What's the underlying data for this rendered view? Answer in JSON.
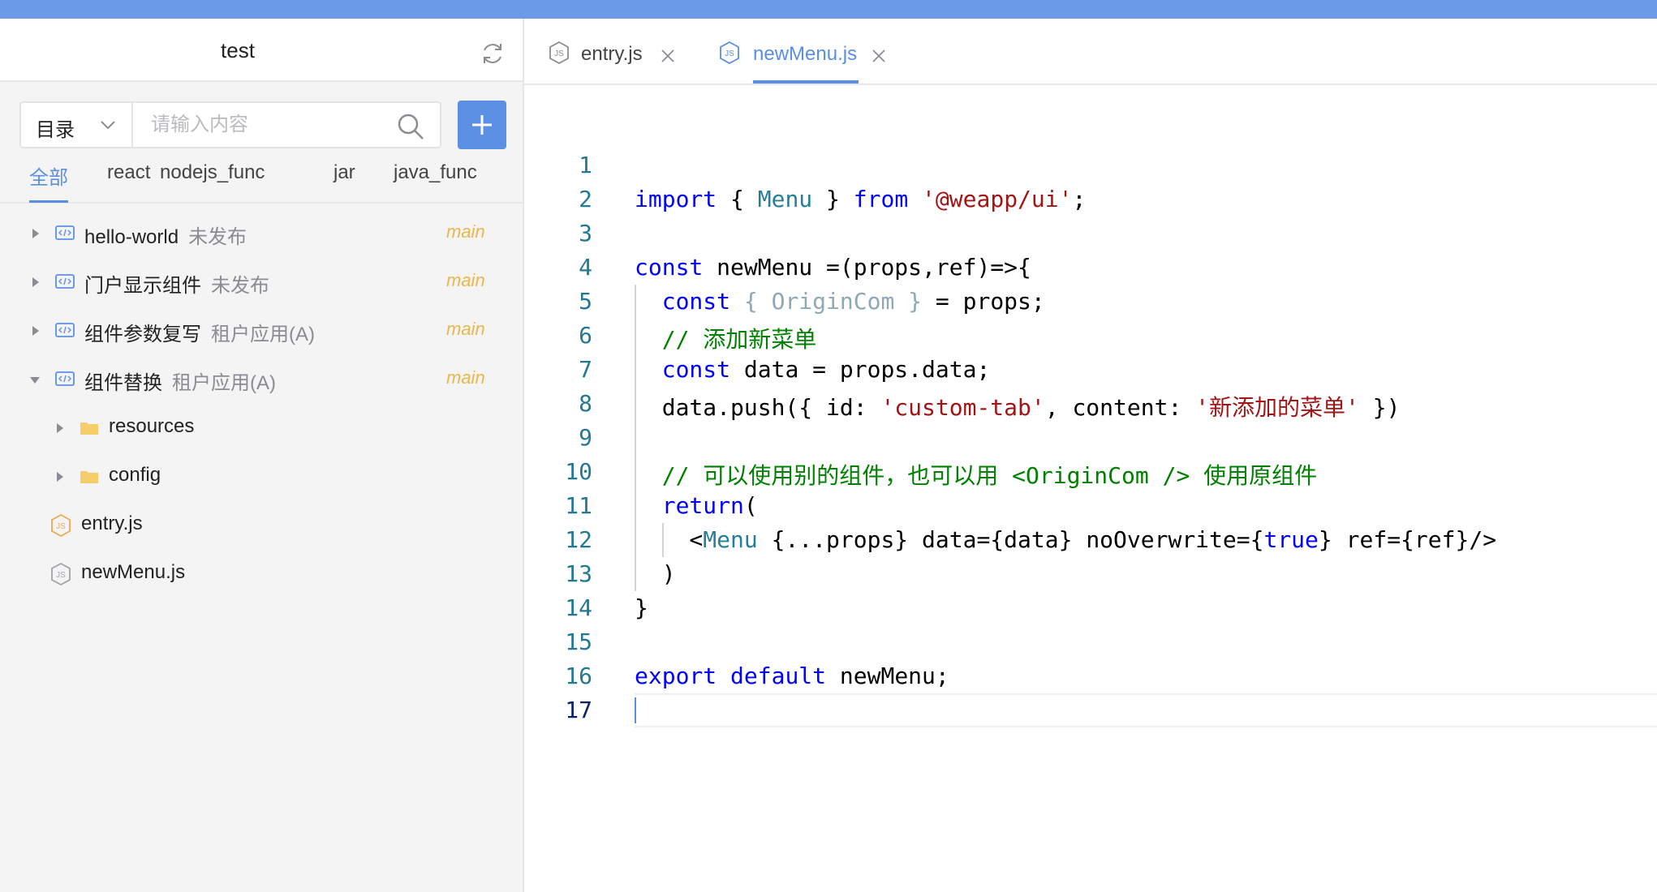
{
  "sidebar": {
    "title": "test",
    "search": {
      "scope": "目录",
      "placeholder": "请输入内容",
      "value": ""
    },
    "filter_tabs": [
      "全部",
      "react",
      "nodejs_func",
      "jar",
      "java_func"
    ],
    "active_filter": "全部",
    "tree": [
      {
        "name": "hello-world",
        "status": "未发布",
        "branch": "main",
        "type": "component",
        "expanded": false
      },
      {
        "name": "门户显示组件",
        "status": "未发布",
        "branch": "main",
        "type": "component",
        "expanded": false
      },
      {
        "name": "组件参数复写",
        "status": "租户应用(A)",
        "branch": "main",
        "type": "component",
        "expanded": false
      },
      {
        "name": "组件替换",
        "status": "租户应用(A)",
        "branch": "main",
        "type": "component",
        "expanded": true
      },
      {
        "name": "resources",
        "type": "folder",
        "expanded": false
      },
      {
        "name": "config",
        "type": "folder",
        "expanded": false
      },
      {
        "name": "entry.js",
        "type": "js-file",
        "icon_color": "#f0a94a"
      },
      {
        "name": "newMenu.js",
        "type": "js-file",
        "icon_color": "#a0a3a8"
      }
    ]
  },
  "editor": {
    "tabs": [
      {
        "label": "entry.js",
        "active": false
      },
      {
        "label": "newMenu.js",
        "active": true
      }
    ],
    "line_numbers": [
      "1",
      "2",
      "3",
      "4",
      "5",
      "6",
      "7",
      "8",
      "9",
      "10",
      "11",
      "12",
      "13",
      "14",
      "15",
      "16",
      "17"
    ],
    "current_line": 17,
    "code_lines": [
      [],
      [
        [
          "kw",
          "import"
        ],
        [
          "p",
          " { "
        ],
        [
          "tag",
          "Menu"
        ],
        [
          "p",
          " } "
        ],
        [
          "kw",
          "from"
        ],
        [
          "p",
          " "
        ],
        [
          "str",
          "'@weapp/ui'"
        ],
        [
          "p",
          ";"
        ]
      ],
      [],
      [
        [
          "kw",
          "const"
        ],
        [
          "p",
          " newMenu =(props,ref)=>{"
        ]
      ],
      [
        [
          "p",
          "  "
        ],
        [
          "kw",
          "const"
        ],
        [
          "p",
          " "
        ],
        [
          "faded",
          "{ OriginCom }"
        ],
        [
          "p",
          " = props;"
        ]
      ],
      [
        [
          "p",
          "  "
        ],
        [
          "cmt",
          "// 添加新菜单"
        ]
      ],
      [
        [
          "p",
          "  "
        ],
        [
          "kw",
          "const"
        ],
        [
          "p",
          " data = props.data;"
        ]
      ],
      [
        [
          "p",
          "  data.push({ id: "
        ],
        [
          "str",
          "'custom-tab'"
        ],
        [
          "p",
          ", content: "
        ],
        [
          "str",
          "'新添加的菜单'"
        ],
        [
          "p",
          " })"
        ]
      ],
      [],
      [
        [
          "p",
          "  "
        ],
        [
          "cmt",
          "// 可以使用别的组件，也可以用 <OriginCom /> 使用原组件"
        ]
      ],
      [
        [
          "p",
          "  "
        ],
        [
          "kw",
          "return"
        ],
        [
          "p",
          "("
        ]
      ],
      [
        [
          "p",
          "    <"
        ],
        [
          "tag",
          "Menu"
        ],
        [
          "p",
          " {...props} data={data} noOverwrite={"
        ],
        [
          "kw",
          "true"
        ],
        [
          "p",
          "} ref={ref}/>"
        ]
      ],
      [
        [
          "p",
          "  )"
        ]
      ],
      [
        [
          "p",
          "}"
        ]
      ],
      [],
      [
        [
          "kw",
          "export"
        ],
        [
          "p",
          " "
        ],
        [
          "kw",
          "default"
        ],
        [
          "p",
          " newMenu;"
        ]
      ],
      []
    ]
  },
  "colors": {
    "topbar": "#6b9be6",
    "accent": "#5b8fe3",
    "branch": "#e9b74a",
    "keyword": "#0000ff",
    "string": "#a31515",
    "comment": "#008000",
    "type": "#267f99",
    "line_number": "#237893"
  }
}
